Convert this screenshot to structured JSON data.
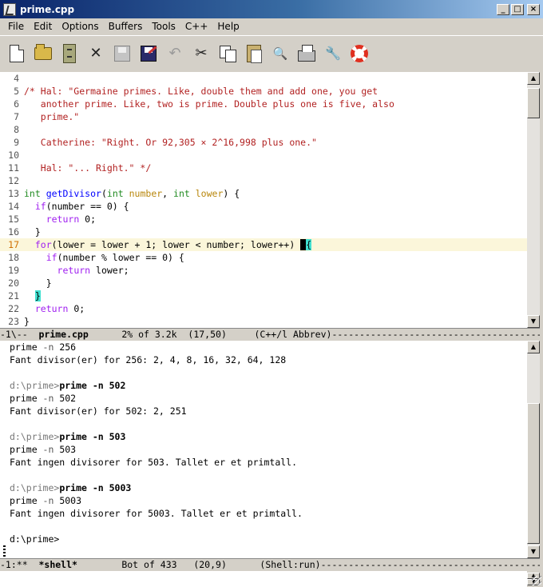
{
  "window": {
    "title": "prime.cpp",
    "buttons": {
      "minimize": "_",
      "maximize": "□",
      "close": "×"
    }
  },
  "menu": [
    "File",
    "Edit",
    "Options",
    "Buffers",
    "Tools",
    "C++",
    "Help"
  ],
  "toolbar": [
    {
      "icon": "new-file-icon",
      "enabled": true
    },
    {
      "icon": "open-folder-icon",
      "enabled": true
    },
    {
      "icon": "dired-cabinet-icon",
      "enabled": true
    },
    {
      "icon": "close-x-icon",
      "enabled": true,
      "glyph": "✕"
    },
    {
      "icon": "save-icon",
      "enabled": false
    },
    {
      "icon": "save-as-icon",
      "enabled": true
    },
    {
      "icon": "undo-icon",
      "enabled": false,
      "glyph": "↶"
    },
    {
      "icon": "cut-icon",
      "enabled": true,
      "glyph": "✂"
    },
    {
      "icon": "copy-icon",
      "enabled": true
    },
    {
      "icon": "paste-icon",
      "enabled": true
    },
    {
      "icon": "search-icon",
      "enabled": true,
      "glyph": "🔍"
    },
    {
      "icon": "print-icon",
      "enabled": true
    },
    {
      "icon": "preferences-icon",
      "enabled": true,
      "glyph": "🔧"
    },
    {
      "icon": "help-lifebuoy-icon",
      "enabled": true
    }
  ],
  "code": {
    "lines": [
      {
        "n": "4",
        "text": ""
      },
      {
        "n": "5",
        "text": "/* Hal: \"Germaine primes. Like, double them and add one, you get"
      },
      {
        "n": "6",
        "text": "   another prime. Like, two is prime. Double plus one is five, also"
      },
      {
        "n": "7",
        "text": "   prime.\""
      },
      {
        "n": "8",
        "text": ""
      },
      {
        "n": "9",
        "text": "   Catherine: \"Right. Or 92,305 × 2^16,998 plus one.\""
      },
      {
        "n": "10",
        "text": ""
      },
      {
        "n": "11",
        "text": "   Hal: \"... Right.\" */"
      },
      {
        "n": "12",
        "text": ""
      },
      {
        "n": "13",
        "text": "int getDivisor(int number, int lower) {"
      },
      {
        "n": "14",
        "text": "  if(number == 0) {"
      },
      {
        "n": "15",
        "text": "    return 0;"
      },
      {
        "n": "16",
        "text": "  }"
      },
      {
        "n": "17",
        "text": "  for(lower = lower + 1; lower < number; lower++) {"
      },
      {
        "n": "18",
        "text": "    if(number % lower == 0) {"
      },
      {
        "n": "19",
        "text": "      return lower;"
      },
      {
        "n": "20",
        "text": "    }"
      },
      {
        "n": "21",
        "text": "  }"
      },
      {
        "n": "22",
        "text": "  return 0;"
      },
      {
        "n": "23",
        "text": "}"
      }
    ]
  },
  "modeline_top": {
    "prefix": "-1\\--  ",
    "buffer": "prime.cpp",
    "position": "      2% of 3.2k  (17,50)     ",
    "mode": "(C++/l Abbrev)",
    "fill": "--------------------------------------------------"
  },
  "shell": {
    "lines": [
      {
        "type": "out",
        "text": "prime -n 256"
      },
      {
        "type": "out",
        "text": "Fant divisor(er) for 256: 2, 4, 8, 16, 32, 64, 128"
      },
      {
        "type": "blank",
        "text": ""
      },
      {
        "type": "cmd",
        "prompt": "d:\\prime>",
        "text": "prime -n 502"
      },
      {
        "type": "out",
        "text": "prime -n 502"
      },
      {
        "type": "out",
        "text": "Fant divisor(er) for 502: 2, 251"
      },
      {
        "type": "blank",
        "text": ""
      },
      {
        "type": "cmd",
        "prompt": "d:\\prime>",
        "text": "prime -n 503"
      },
      {
        "type": "out",
        "text": "prime -n 503"
      },
      {
        "type": "out",
        "text": "Fant ingen divisorer for 503. Tallet er et primtall."
      },
      {
        "type": "blank",
        "text": ""
      },
      {
        "type": "cmd",
        "prompt": "d:\\prime>",
        "text": "prime -n 5003"
      },
      {
        "type": "out",
        "text": "prime -n 5003"
      },
      {
        "type": "out",
        "text": "Fant ingen divisorer for 5003. Tallet er et primtall."
      },
      {
        "type": "blank",
        "text": ""
      },
      {
        "type": "prompt",
        "prompt": "d:\\prime>",
        "text": ""
      }
    ]
  },
  "modeline_bottom": {
    "prefix": "-1:**  ",
    "buffer": "*shell*",
    "position": "        Bot of 433   (20,9)      ",
    "mode": "(Shell:run)",
    "fill": "--------------------------------------------------"
  }
}
